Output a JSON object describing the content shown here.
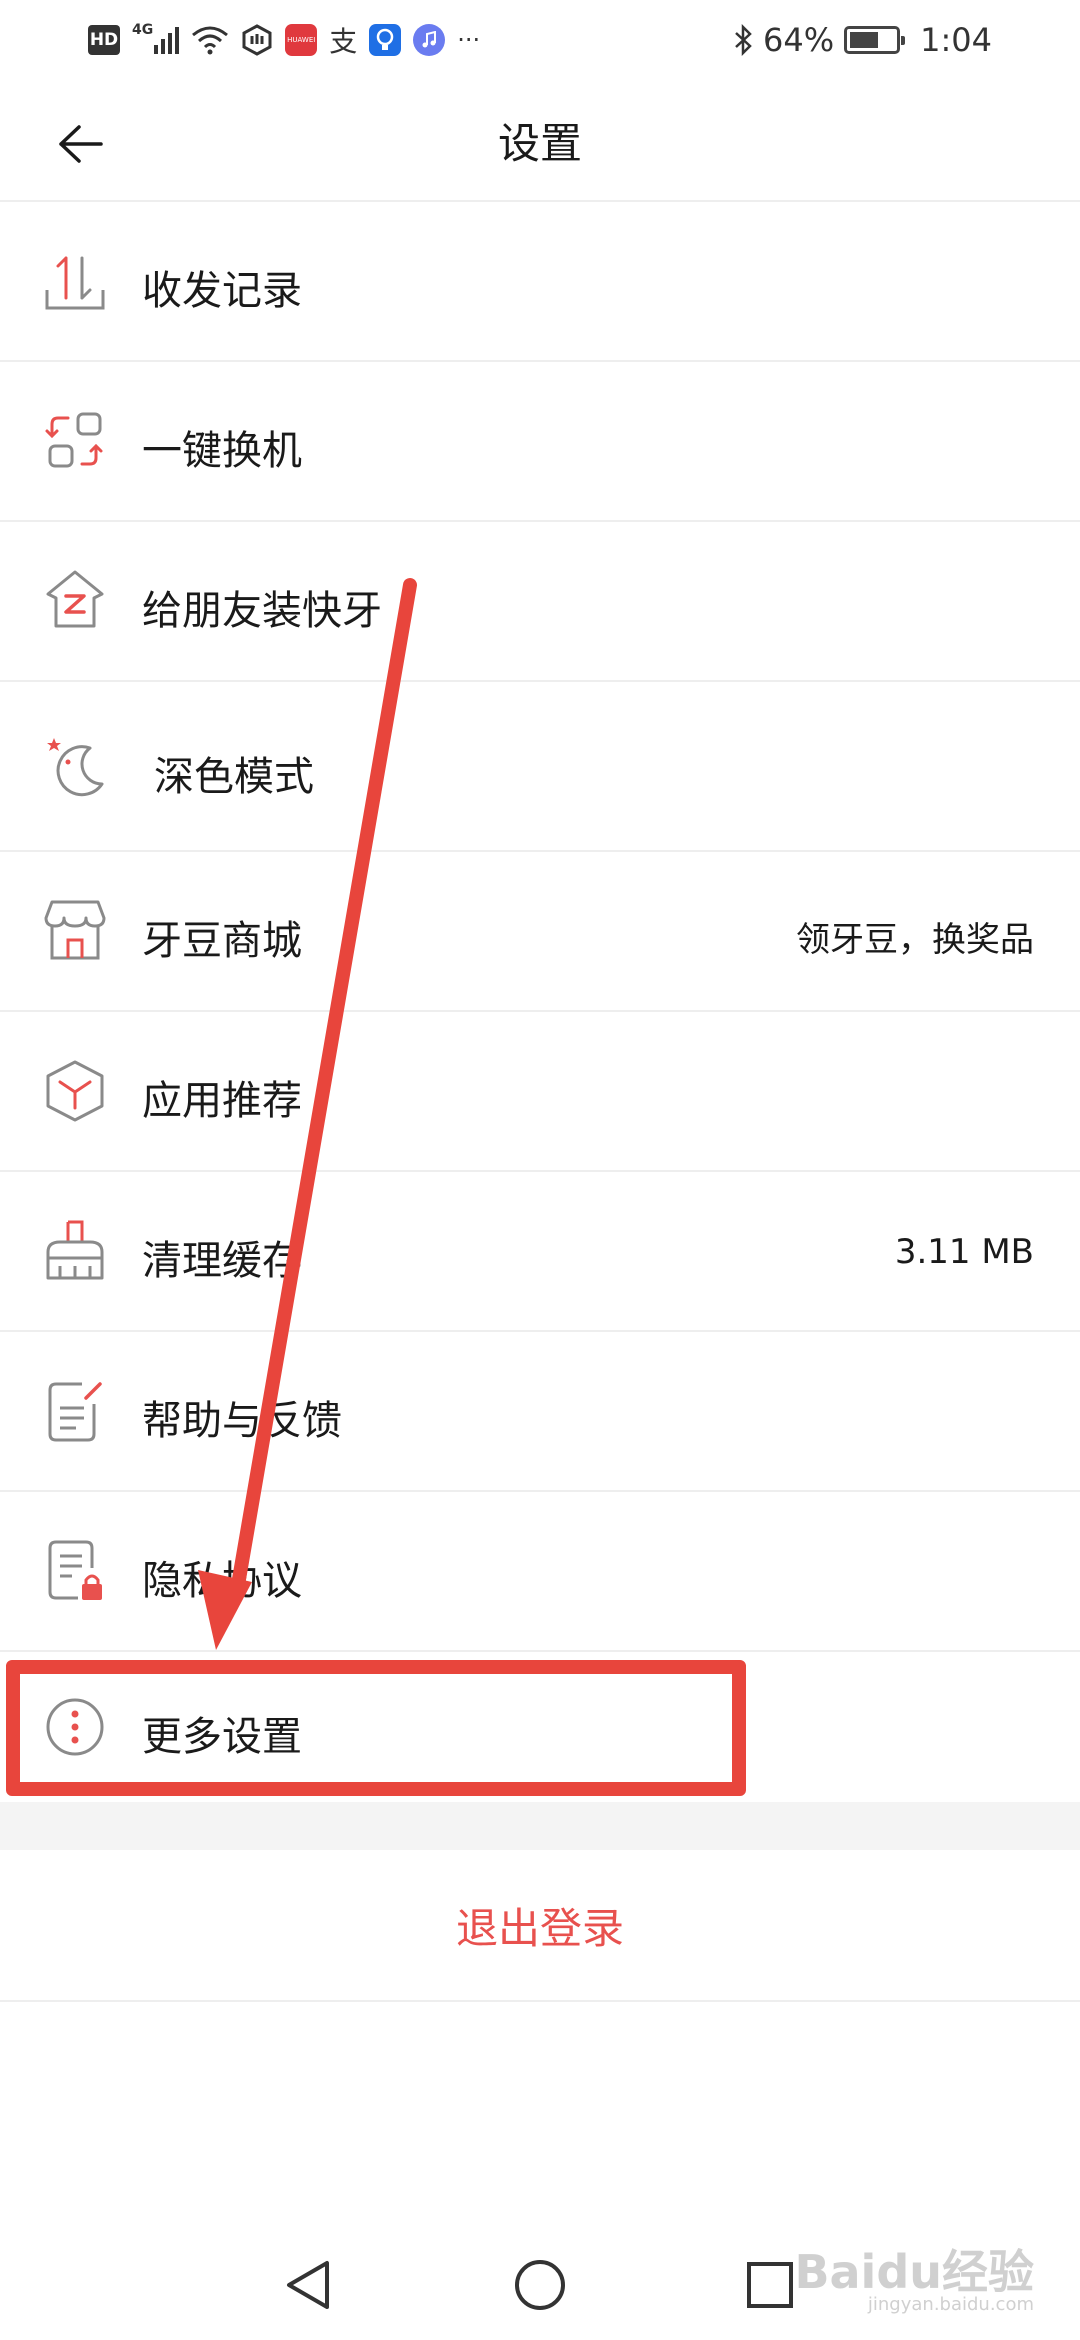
{
  "status_bar": {
    "left_icons": [
      "hd-icon",
      "4g-signal-icon",
      "wifi-icon",
      "nfc-icon",
      "huawei-app-icon",
      "alipay-icon",
      "bulb-app-icon",
      "music-app-icon",
      "more-icon"
    ],
    "hd": "HD",
    "net": "4G",
    "huawei_label": "HUAWEI",
    "alipay_char": "支",
    "more": "···",
    "battery_percent_text": "64%",
    "battery_level": 0.64,
    "time": "1:04"
  },
  "header": {
    "title": "设置"
  },
  "items": [
    {
      "label": "收发记录",
      "icon": "transfer-arrows-icon",
      "value": ""
    },
    {
      "label": "一键换机",
      "icon": "phone-switch-icon",
      "value": ""
    },
    {
      "label": "给朋友装快牙",
      "icon": "house-share-icon",
      "value": ""
    },
    {
      "label": "深色模式",
      "icon": "moon-icon",
      "value": ""
    },
    {
      "label": "牙豆商城",
      "icon": "store-icon",
      "value": "领牙豆，换奖品"
    },
    {
      "label": "应用推荐",
      "icon": "cube-icon",
      "value": ""
    },
    {
      "label": "清理缓存",
      "icon": "broom-icon",
      "value": "3.11 MB"
    },
    {
      "label": "帮助与反馈",
      "icon": "feedback-doc-icon",
      "value": ""
    },
    {
      "label": "隐私协议",
      "icon": "privacy-lock-doc-icon",
      "value": ""
    },
    {
      "label": "更多设置",
      "icon": "more-vertical-icon",
      "value": ""
    }
  ],
  "logout": {
    "label": "退出登录"
  },
  "colors": {
    "accent": "#e8514e",
    "annotation": "#e8453c",
    "icon_gray": "#8a8a8a",
    "divider": "#eeeeee"
  },
  "watermark": {
    "text": "Baidu经验",
    "sub": "jingyan.baidu.com"
  }
}
